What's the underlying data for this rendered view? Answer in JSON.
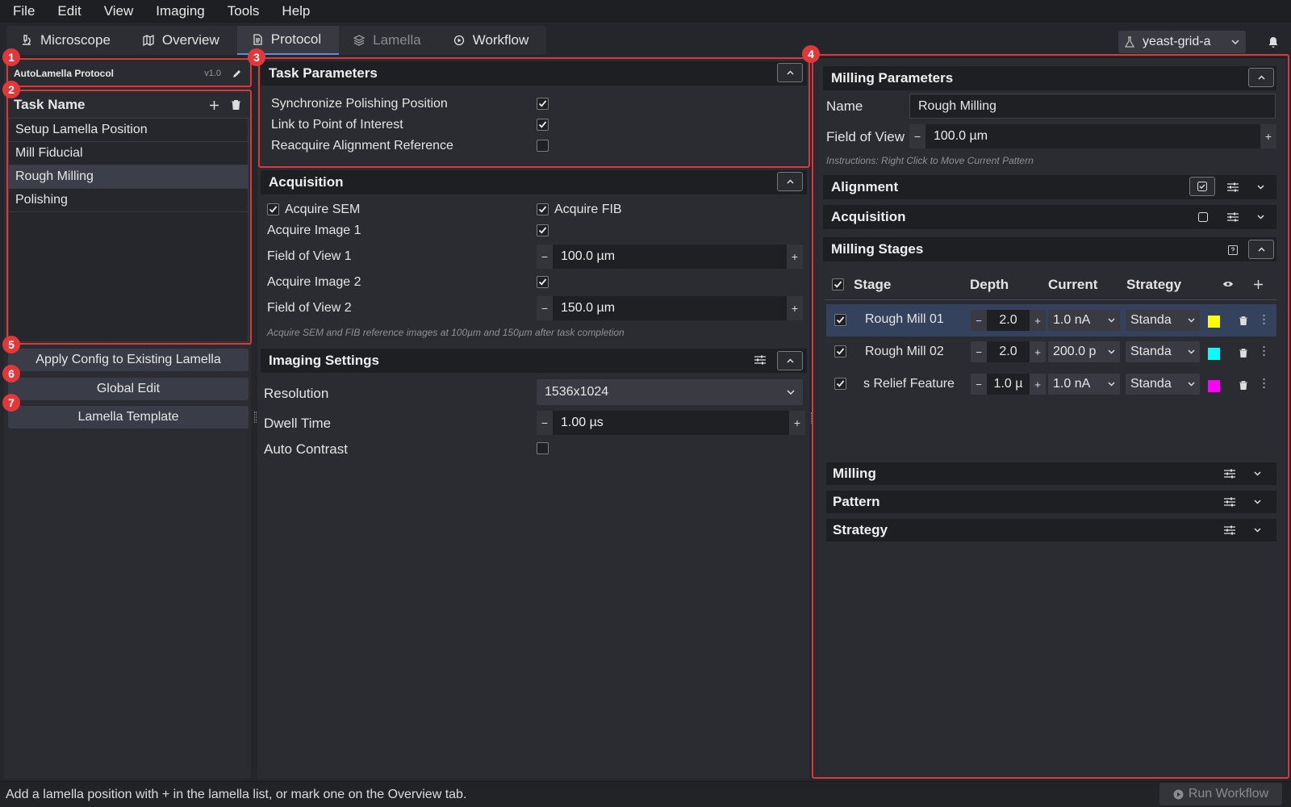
{
  "menu": [
    "File",
    "Edit",
    "View",
    "Imaging",
    "Tools",
    "Help"
  ],
  "tabs": [
    {
      "label": "Microscope",
      "icon": "microscope-icon"
    },
    {
      "label": "Overview",
      "icon": "map-icon"
    },
    {
      "label": "Protocol",
      "icon": "document-icon"
    },
    {
      "label": "Lamella",
      "icon": "layers-icon"
    },
    {
      "label": "Workflow",
      "icon": "play-circle-icon"
    }
  ],
  "experiment_selector": {
    "value": "yeast-grid-a",
    "icon": "flask-icon"
  },
  "protocol": {
    "title": "AutoLamella Protocol",
    "version": "v1.0"
  },
  "task_list": {
    "header": "Task Name",
    "items": [
      "Setup Lamella Position",
      "Mill Fiducial",
      "Rough Milling",
      "Polishing"
    ],
    "selected": "Rough Milling"
  },
  "left_buttons": {
    "apply_config": "Apply Config to Existing Lamella",
    "global_edit": "Global Edit",
    "lamella_template": "Lamella Template"
  },
  "badges": [
    "1",
    "2",
    "3",
    "4",
    "5",
    "6",
    "7"
  ],
  "task_parameters": {
    "title": "Task Parameters",
    "items": [
      {
        "label": "Synchronize Polishing Position",
        "checked": true
      },
      {
        "label": "Link to Point of Interest",
        "checked": true
      },
      {
        "label": "Reacquire Alignment Reference",
        "checked": false
      }
    ]
  },
  "acquisition": {
    "title": "Acquisition",
    "acquire_sem": "Acquire SEM",
    "acquire_fib": "Acquire FIB",
    "acquire_image_1": "Acquire Image 1",
    "fov1_label": "Field of View 1",
    "fov1_value": "100.0  µm",
    "acquire_image_2": "Acquire Image 2",
    "fov2_label": "Field of View 2",
    "fov2_value": "150.0  µm",
    "hint": "Acquire SEM and FIB reference images at 100µm and 150µm after task completion"
  },
  "imaging_settings": {
    "title": "Imaging Settings",
    "resolution_label": "Resolution",
    "resolution_value": "1536x1024",
    "dwell_label": "Dwell Time",
    "dwell_value": "1.00 µs",
    "auto_contrast_label": "Auto Contrast",
    "auto_contrast": false
  },
  "milling_parameters": {
    "title": "Milling Parameters",
    "name_label": "Name",
    "name_value": "Rough Milling",
    "fov_label": "Field of View",
    "fov_value": "100.0  µm",
    "instructions": "Instructions: Right Click to Move Current Pattern"
  },
  "sections": {
    "alignment": "Alignment",
    "acquisition": "Acquisition",
    "milling_stages": "Milling Stages",
    "milling": "Milling",
    "pattern": "Pattern",
    "strategy": "Strategy"
  },
  "stages_table": {
    "headers": {
      "stage": "Stage",
      "depth": "Depth",
      "current": "Current",
      "strategy": "Strategy"
    },
    "rows": [
      {
        "name": "Rough Mill 01",
        "depth": "2.0",
        "current": "1.0 nA",
        "strategy": "Standa",
        "color": "#ffff00",
        "enabled": true
      },
      {
        "name": "Rough Mill 02",
        "depth": "2.0",
        "current": "200.0 p",
        "strategy": "Standa",
        "color": "#00ffff",
        "enabled": true
      },
      {
        "name": "s Relief Feature",
        "depth": "1.0 µ",
        "current": "1.0 nA",
        "strategy": "Standa",
        "color": "#ff00ff",
        "enabled": true
      }
    ]
  },
  "status_bar": {
    "message": "Add a lamella position with + in the lamella list, or mark one on the Overview tab."
  },
  "run_workflow": "Run Workflow",
  "colors": {
    "accent": "#5b8fd9",
    "highlight": "#d83a3a",
    "selected_row": "#35425e"
  }
}
